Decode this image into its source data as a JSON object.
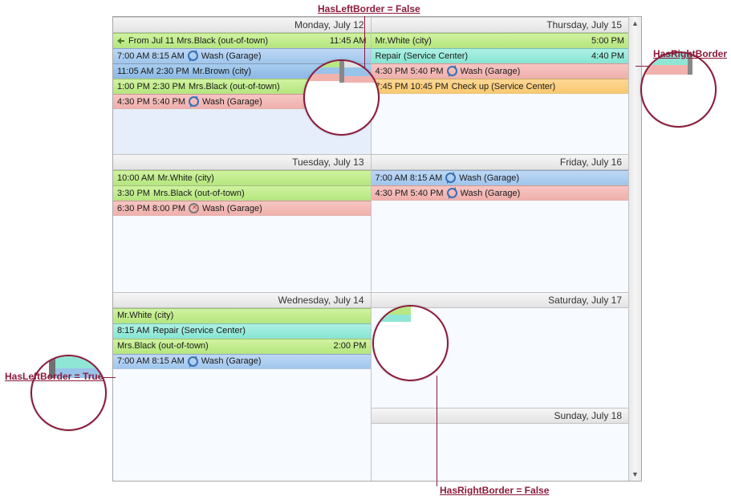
{
  "annotations": {
    "top_center": "HasLeftBorder = False",
    "top_right": "HasRightBorder",
    "left": "HasLeftBorder = True",
    "bottom": "HasRightBorder = False"
  },
  "colors": {
    "green": "#b6e77f",
    "blue": "#a0c6ed",
    "pink": "#f0b0ac",
    "cyan": "#87e6d3",
    "orange": "#f7c971",
    "anno": "#8b1a3a"
  },
  "icon_names": {
    "arrow_left": "arrow-left-icon",
    "recurring": "recurring-icon",
    "recurring_cancel": "recurring-cancel-icon"
  },
  "days": {
    "mon": {
      "header": "Monday, July 12",
      "a0": {
        "prefix_icon": "arrow-left",
        "label": "From Jul 11 Mrs.Black (out-of-town)",
        "right": "11:45 AM",
        "color": "green"
      },
      "a1": {
        "times": "7:00 AM  8:15 AM",
        "icon": "recurring",
        "label": "Wash (Garage)",
        "color": "blue"
      },
      "a2": {
        "times": "11:05 AM  2:30 PM",
        "label": "Mr.Brown (city)",
        "color": "blue2"
      },
      "a3": {
        "times": "1:00 PM  2:30 PM",
        "label": "Mrs.Black (out-of-town)",
        "color": "green"
      },
      "a4": {
        "times": "4:30 PM  5:40 PM",
        "icon": "recurring",
        "label": "Wash (Garage)",
        "color": "pink"
      }
    },
    "thu": {
      "header": "Thursday, July 15",
      "a0": {
        "label": "Mr.White (city)",
        "right": "5:00 PM",
        "color": "green"
      },
      "a1": {
        "label": "Repair (Service Center)",
        "right": "4:40 PM",
        "color": "cyan"
      },
      "a2": {
        "times": "4:30 PM  5:40 PM",
        "icon": "recurring",
        "label": "Wash (Garage)",
        "color": "pink"
      },
      "a3": {
        "times": "7:45 PM  10:45 PM",
        "label": "Check up (Service Center)",
        "color": "orange"
      }
    },
    "tue": {
      "header": "Tuesday, July 13",
      "a0": {
        "times": "10:00 AM",
        "label": "Mr.White (city)",
        "color": "green"
      },
      "a1": {
        "times": "3:30 PM",
        "label": "Mrs.Black (out-of-town)",
        "color": "green"
      },
      "a2": {
        "times": "6:30 PM  8:00 PM",
        "icon": "recurring-cancel",
        "label": "Wash (Garage)",
        "color": "pink"
      }
    },
    "fri": {
      "header": "Friday, July 16",
      "a0": {
        "times": "7:00 AM  8:15 AM",
        "icon": "recurring",
        "label": "Wash (Garage)",
        "color": "blue"
      },
      "a1": {
        "times": "4:30 PM  5:40 PM",
        "icon": "recurring",
        "label": "Wash (Garage)",
        "color": "pink"
      }
    },
    "wed": {
      "header": "Wednesday, July 14",
      "a0": {
        "label": "Mr.White (city)",
        "color": "green"
      },
      "a1": {
        "times": "8:15 AM",
        "label": "Repair (Service Center)",
        "color": "cyan"
      },
      "a2": {
        "label": "Mrs.Black (out-of-town)",
        "right": "2:00 PM",
        "color": "green"
      },
      "a3": {
        "times": "7:00 AM  8:15 AM",
        "icon": "recurring",
        "label": "Wash (Garage)",
        "color": "blue"
      }
    },
    "sat": {
      "header": "Saturday, July 17"
    },
    "sun": {
      "header": "Sunday, July 18"
    }
  }
}
